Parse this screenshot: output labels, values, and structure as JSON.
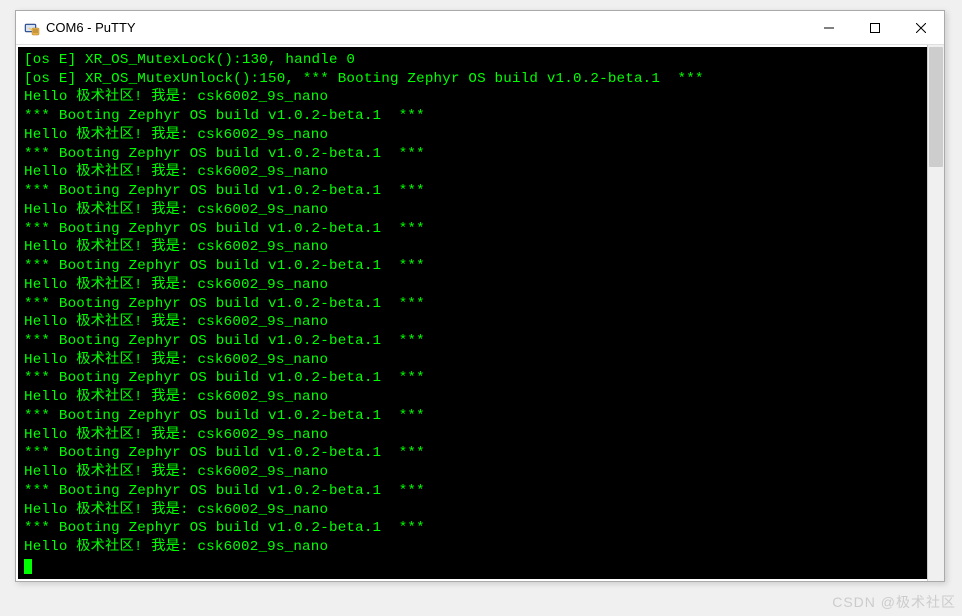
{
  "window": {
    "title": "COM6 - PuTTY"
  },
  "terminal": {
    "lines": [
      "[os E] XR_OS_MutexLock():130, handle 0",
      "[os E] XR_OS_MutexUnlock():150, *** Booting Zephyr OS build v1.0.2-beta.1  ***",
      "Hello 极术社区! 我是: csk6002_9s_nano",
      "*** Booting Zephyr OS build v1.0.2-beta.1  ***",
      "Hello 极术社区! 我是: csk6002_9s_nano",
      "*** Booting Zephyr OS build v1.0.2-beta.1  ***",
      "Hello 极术社区! 我是: csk6002_9s_nano",
      "*** Booting Zephyr OS build v1.0.2-beta.1  ***",
      "Hello 极术社区! 我是: csk6002_9s_nano",
      "*** Booting Zephyr OS build v1.0.2-beta.1  ***",
      "Hello 极术社区! 我是: csk6002_9s_nano",
      "*** Booting Zephyr OS build v1.0.2-beta.1  ***",
      "Hello 极术社区! 我是: csk6002_9s_nano",
      "*** Booting Zephyr OS build v1.0.2-beta.1  ***",
      "Hello 极术社区! 我是: csk6002_9s_nano",
      "*** Booting Zephyr OS build v1.0.2-beta.1  ***",
      "Hello 极术社区! 我是: csk6002_9s_nano",
      "*** Booting Zephyr OS build v1.0.2-beta.1  ***",
      "Hello 极术社区! 我是: csk6002_9s_nano",
      "*** Booting Zephyr OS build v1.0.2-beta.1  ***",
      "Hello 极术社区! 我是: csk6002_9s_nano",
      "*** Booting Zephyr OS build v1.0.2-beta.1  ***",
      "Hello 极术社区! 我是: csk6002_9s_nano",
      "*** Booting Zephyr OS build v1.0.2-beta.1  ***",
      "Hello 极术社区! 我是: csk6002_9s_nano",
      "*** Booting Zephyr OS build v1.0.2-beta.1  ***",
      "Hello 极术社区! 我是: csk6002_9s_nano"
    ]
  },
  "watermark": "CSDN @极术社区"
}
